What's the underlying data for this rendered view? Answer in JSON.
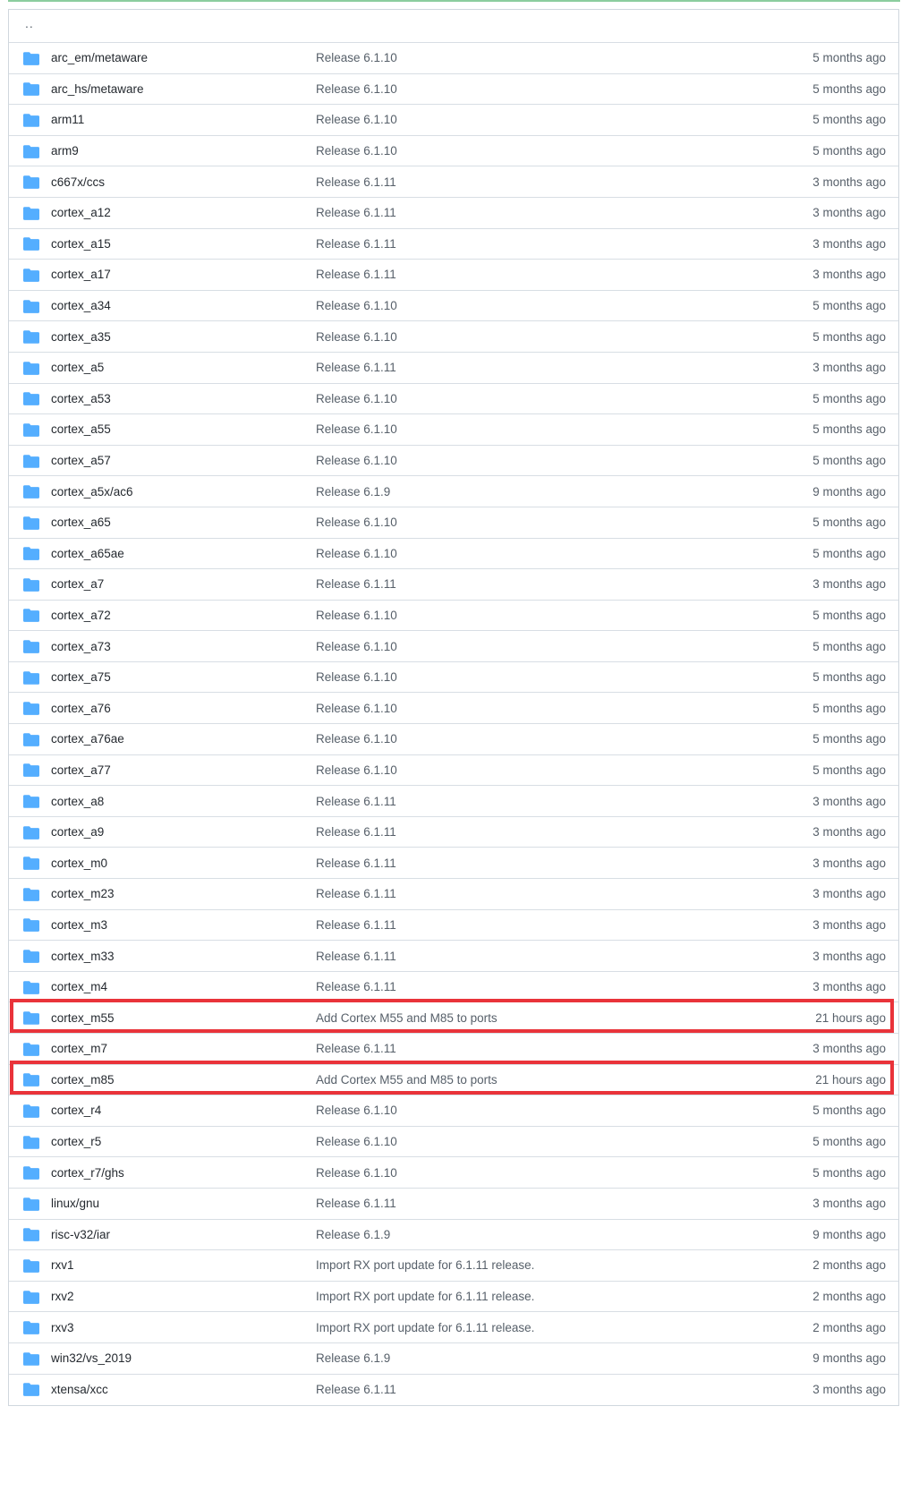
{
  "parent_row": {
    "label": ".."
  },
  "highlight_color": "#e9333a",
  "folder_icon_color": "#54aeff",
  "rows": [
    {
      "name": "arc_em/metaware",
      "message": "Release 6.1.10",
      "age": "5 months ago",
      "highlighted": false
    },
    {
      "name": "arc_hs/metaware",
      "message": "Release 6.1.10",
      "age": "5 months ago",
      "highlighted": false
    },
    {
      "name": "arm11",
      "message": "Release 6.1.10",
      "age": "5 months ago",
      "highlighted": false
    },
    {
      "name": "arm9",
      "message": "Release 6.1.10",
      "age": "5 months ago",
      "highlighted": false
    },
    {
      "name": "c667x/ccs",
      "message": "Release 6.1.11",
      "age": "3 months ago",
      "highlighted": false
    },
    {
      "name": "cortex_a12",
      "message": "Release 6.1.11",
      "age": "3 months ago",
      "highlighted": false
    },
    {
      "name": "cortex_a15",
      "message": "Release 6.1.11",
      "age": "3 months ago",
      "highlighted": false
    },
    {
      "name": "cortex_a17",
      "message": "Release 6.1.11",
      "age": "3 months ago",
      "highlighted": false
    },
    {
      "name": "cortex_a34",
      "message": "Release 6.1.10",
      "age": "5 months ago",
      "highlighted": false
    },
    {
      "name": "cortex_a35",
      "message": "Release 6.1.10",
      "age": "5 months ago",
      "highlighted": false
    },
    {
      "name": "cortex_a5",
      "message": "Release 6.1.11",
      "age": "3 months ago",
      "highlighted": false
    },
    {
      "name": "cortex_a53",
      "message": "Release 6.1.10",
      "age": "5 months ago",
      "highlighted": false
    },
    {
      "name": "cortex_a55",
      "message": "Release 6.1.10",
      "age": "5 months ago",
      "highlighted": false
    },
    {
      "name": "cortex_a57",
      "message": "Release 6.1.10",
      "age": "5 months ago",
      "highlighted": false
    },
    {
      "name": "cortex_a5x/ac6",
      "message": "Release 6.1.9",
      "age": "9 months ago",
      "highlighted": false
    },
    {
      "name": "cortex_a65",
      "message": "Release 6.1.10",
      "age": "5 months ago",
      "highlighted": false
    },
    {
      "name": "cortex_a65ae",
      "message": "Release 6.1.10",
      "age": "5 months ago",
      "highlighted": false
    },
    {
      "name": "cortex_a7",
      "message": "Release 6.1.11",
      "age": "3 months ago",
      "highlighted": false
    },
    {
      "name": "cortex_a72",
      "message": "Release 6.1.10",
      "age": "5 months ago",
      "highlighted": false
    },
    {
      "name": "cortex_a73",
      "message": "Release 6.1.10",
      "age": "5 months ago",
      "highlighted": false
    },
    {
      "name": "cortex_a75",
      "message": "Release 6.1.10",
      "age": "5 months ago",
      "highlighted": false
    },
    {
      "name": "cortex_a76",
      "message": "Release 6.1.10",
      "age": "5 months ago",
      "highlighted": false
    },
    {
      "name": "cortex_a76ae",
      "message": "Release 6.1.10",
      "age": "5 months ago",
      "highlighted": false
    },
    {
      "name": "cortex_a77",
      "message": "Release 6.1.10",
      "age": "5 months ago",
      "highlighted": false
    },
    {
      "name": "cortex_a8",
      "message": "Release 6.1.11",
      "age": "3 months ago",
      "highlighted": false
    },
    {
      "name": "cortex_a9",
      "message": "Release 6.1.11",
      "age": "3 months ago",
      "highlighted": false
    },
    {
      "name": "cortex_m0",
      "message": "Release 6.1.11",
      "age": "3 months ago",
      "highlighted": false
    },
    {
      "name": "cortex_m23",
      "message": "Release 6.1.11",
      "age": "3 months ago",
      "highlighted": false
    },
    {
      "name": "cortex_m3",
      "message": "Release 6.1.11",
      "age": "3 months ago",
      "highlighted": false
    },
    {
      "name": "cortex_m33",
      "message": "Release 6.1.11",
      "age": "3 months ago",
      "highlighted": false
    },
    {
      "name": "cortex_m4",
      "message": "Release 6.1.11",
      "age": "3 months ago",
      "highlighted": false
    },
    {
      "name": "cortex_m55",
      "message": "Add Cortex M55 and M85 to ports",
      "age": "21 hours ago",
      "highlighted": true
    },
    {
      "name": "cortex_m7",
      "message": "Release 6.1.11",
      "age": "3 months ago",
      "highlighted": false
    },
    {
      "name": "cortex_m85",
      "message": "Add Cortex M55 and M85 to ports",
      "age": "21 hours ago",
      "highlighted": true
    },
    {
      "name": "cortex_r4",
      "message": "Release 6.1.10",
      "age": "5 months ago",
      "highlighted": false
    },
    {
      "name": "cortex_r5",
      "message": "Release 6.1.10",
      "age": "5 months ago",
      "highlighted": false
    },
    {
      "name": "cortex_r7/ghs",
      "message": "Release 6.1.10",
      "age": "5 months ago",
      "highlighted": false
    },
    {
      "name": "linux/gnu",
      "message": "Release 6.1.11",
      "age": "3 months ago",
      "highlighted": false
    },
    {
      "name": "risc-v32/iar",
      "message": "Release 6.1.9",
      "age": "9 months ago",
      "highlighted": false
    },
    {
      "name": "rxv1",
      "message": "Import RX port update for 6.1.11 release.",
      "age": "2 months ago",
      "highlighted": false
    },
    {
      "name": "rxv2",
      "message": "Import RX port update for 6.1.11 release.",
      "age": "2 months ago",
      "highlighted": false
    },
    {
      "name": "rxv3",
      "message": "Import RX port update for 6.1.11 release.",
      "age": "2 months ago",
      "highlighted": false
    },
    {
      "name": "win32/vs_2019",
      "message": "Release 6.1.9",
      "age": "9 months ago",
      "highlighted": false
    },
    {
      "name": "xtensa/xcc",
      "message": "Release 6.1.11",
      "age": "3 months ago",
      "highlighted": false
    }
  ]
}
